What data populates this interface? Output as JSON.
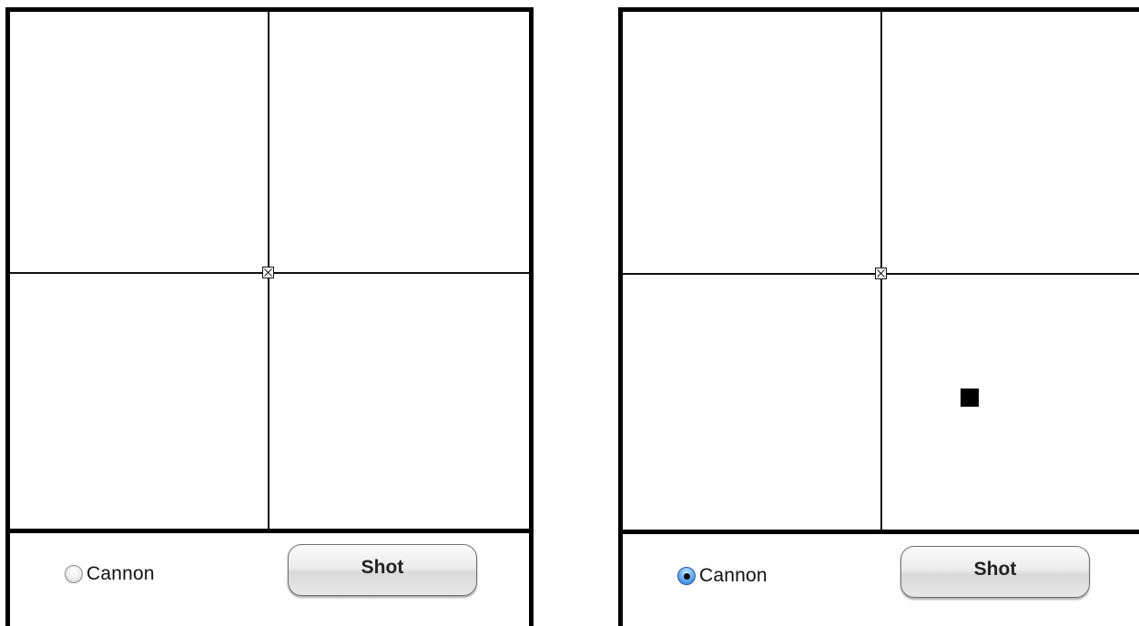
{
  "panels": [
    {
      "id": "left",
      "radio": {
        "label": "Cannon",
        "selected": false
      },
      "button": {
        "label": "Shot"
      },
      "projectile_visible": false
    },
    {
      "id": "right",
      "radio": {
        "label": "Cannon",
        "selected": true
      },
      "button": {
        "label": "Shot"
      },
      "projectile_visible": true
    }
  ],
  "colors": {
    "border": "#000000",
    "canvas": "#ffffff",
    "radio_selected": "#2b78d6",
    "projectile": "#000000"
  },
  "icons": {
    "origin_marker": "boxed-x-icon",
    "projectile": "square-icon"
  }
}
